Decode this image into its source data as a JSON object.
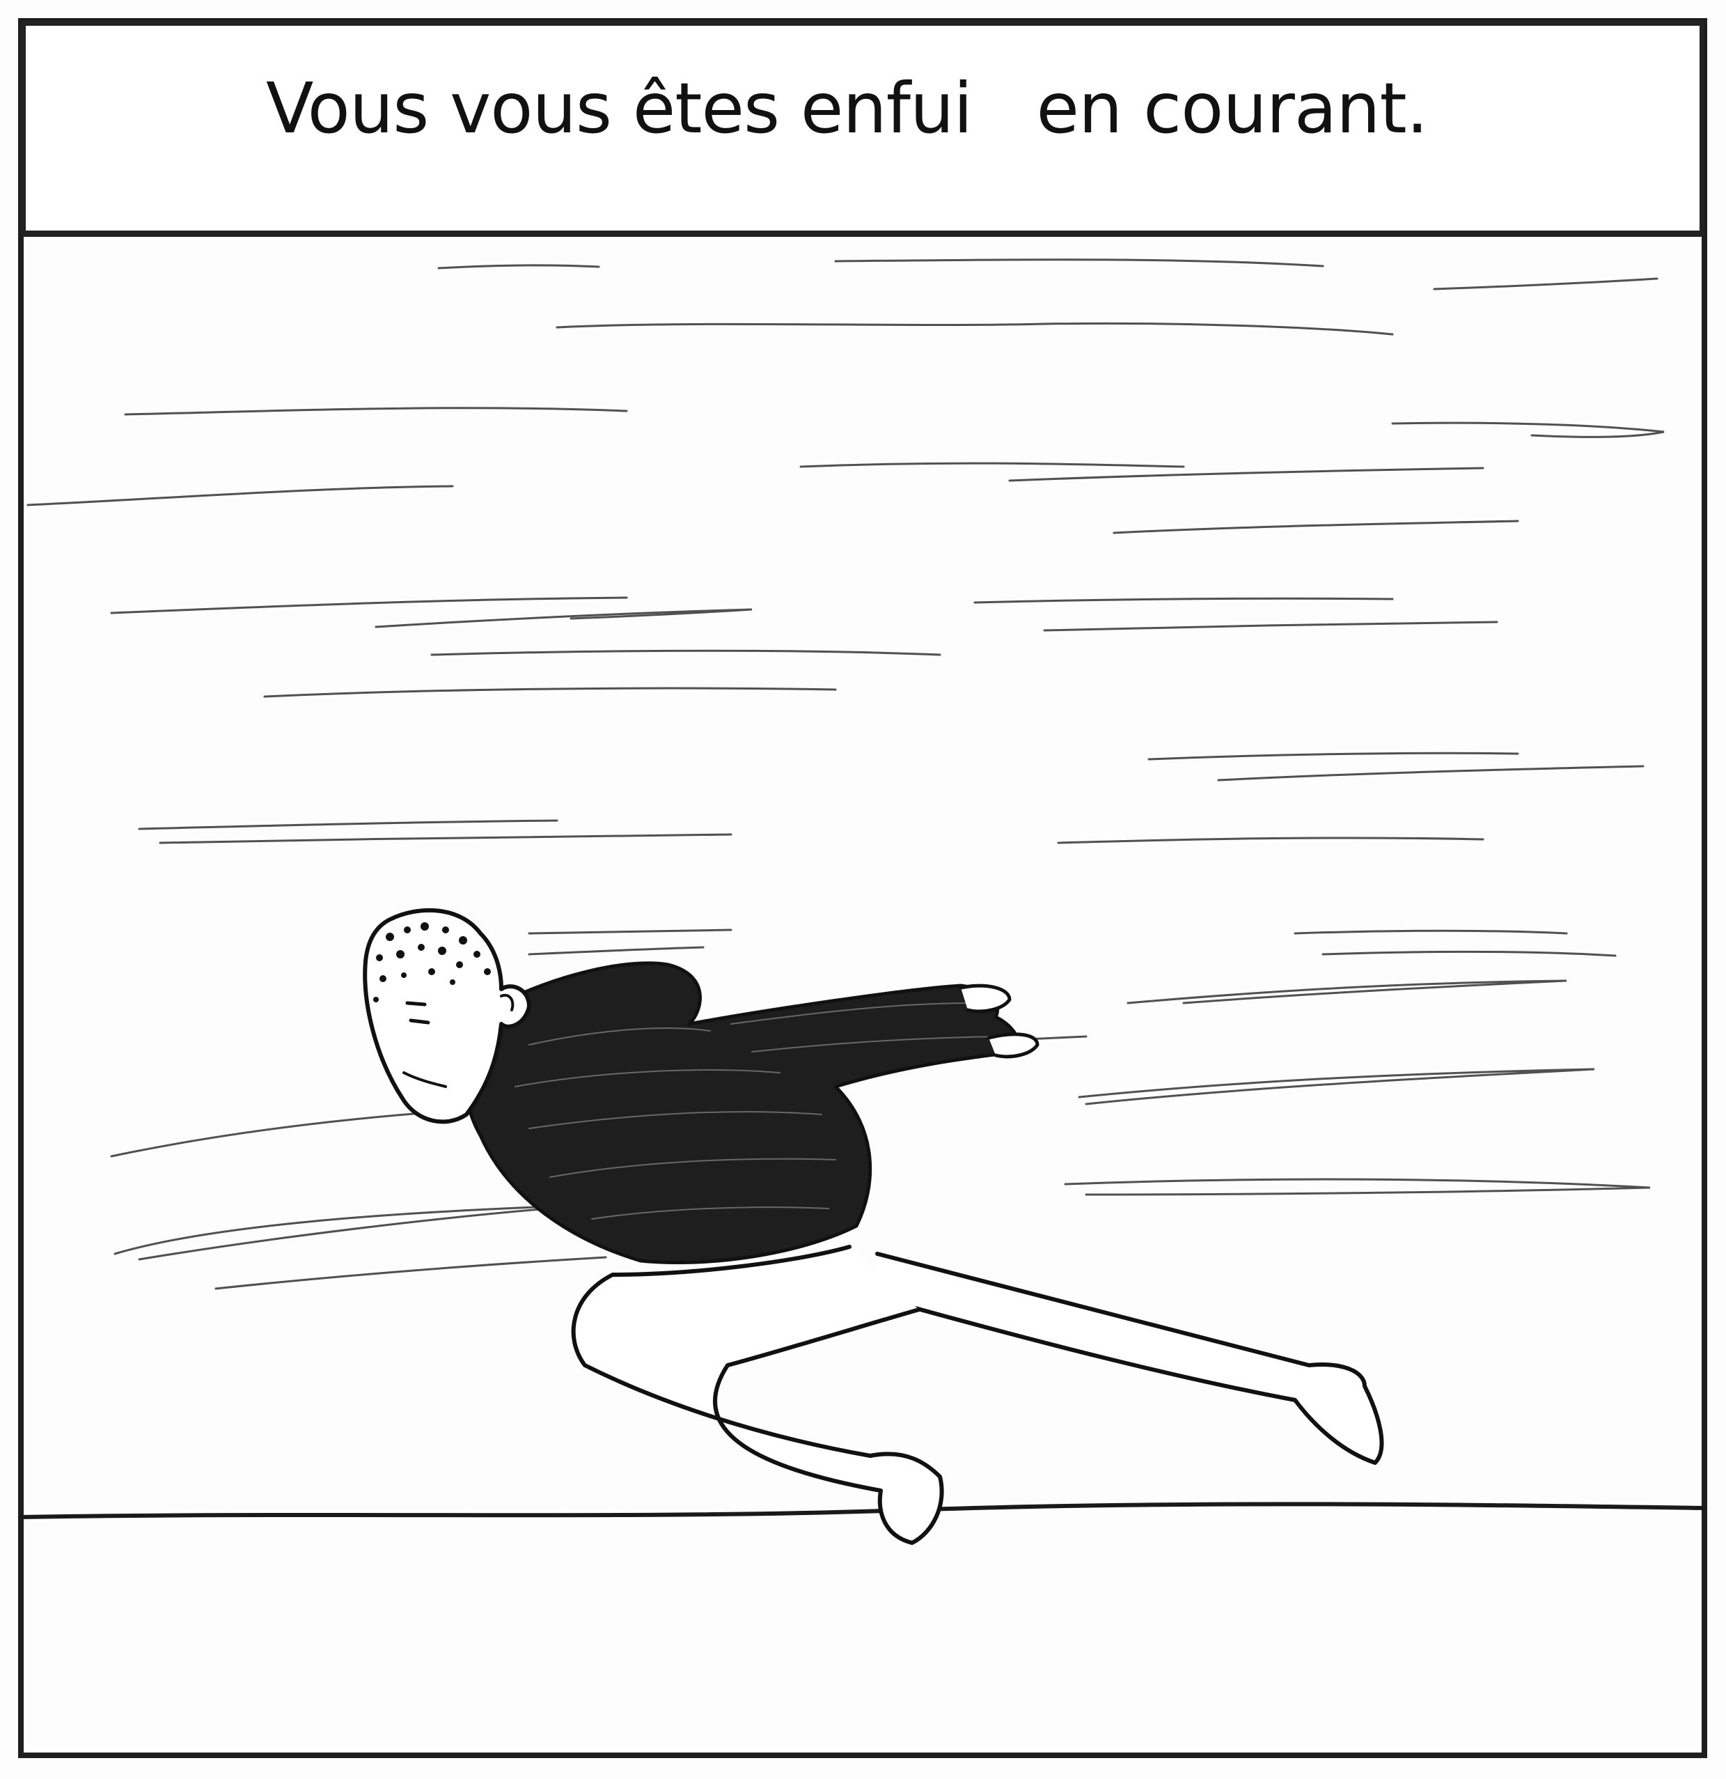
{
  "caption": {
    "text": "Vous vous êtes enfui   en courant."
  },
  "illustration": {
    "subject": "running-man",
    "ink_color": "#1a1a1a",
    "paper_color": "#fdfdfd"
  }
}
